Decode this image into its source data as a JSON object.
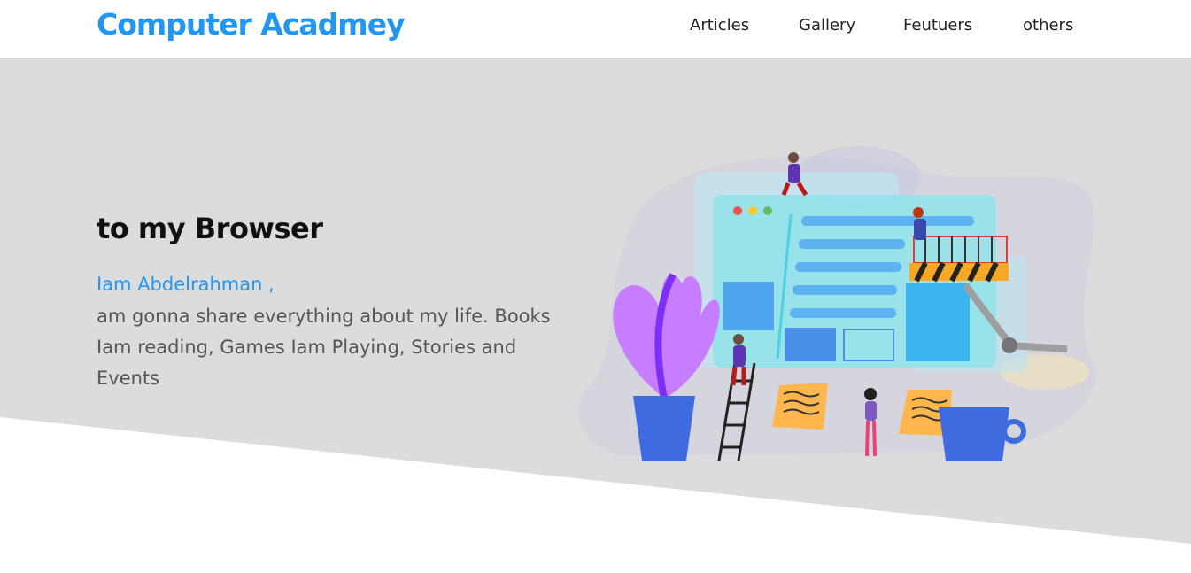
{
  "brand": {
    "name": "Computer Acadmey",
    "color": "#2196f3"
  },
  "nav": {
    "items": [
      {
        "label": "Articles"
      },
      {
        "label": "Gallery"
      },
      {
        "label": "Feutuers"
      },
      {
        "label": "others"
      }
    ]
  },
  "hero": {
    "title": "to my Browser",
    "name_line": "Iam Abdelrahman ,",
    "description": "am gonna share everything about my life. Books Iam reading, Games Iam Playing, Stories and Events",
    "background_color": "#dcdcdc",
    "illustration": "web-development-illustration"
  }
}
